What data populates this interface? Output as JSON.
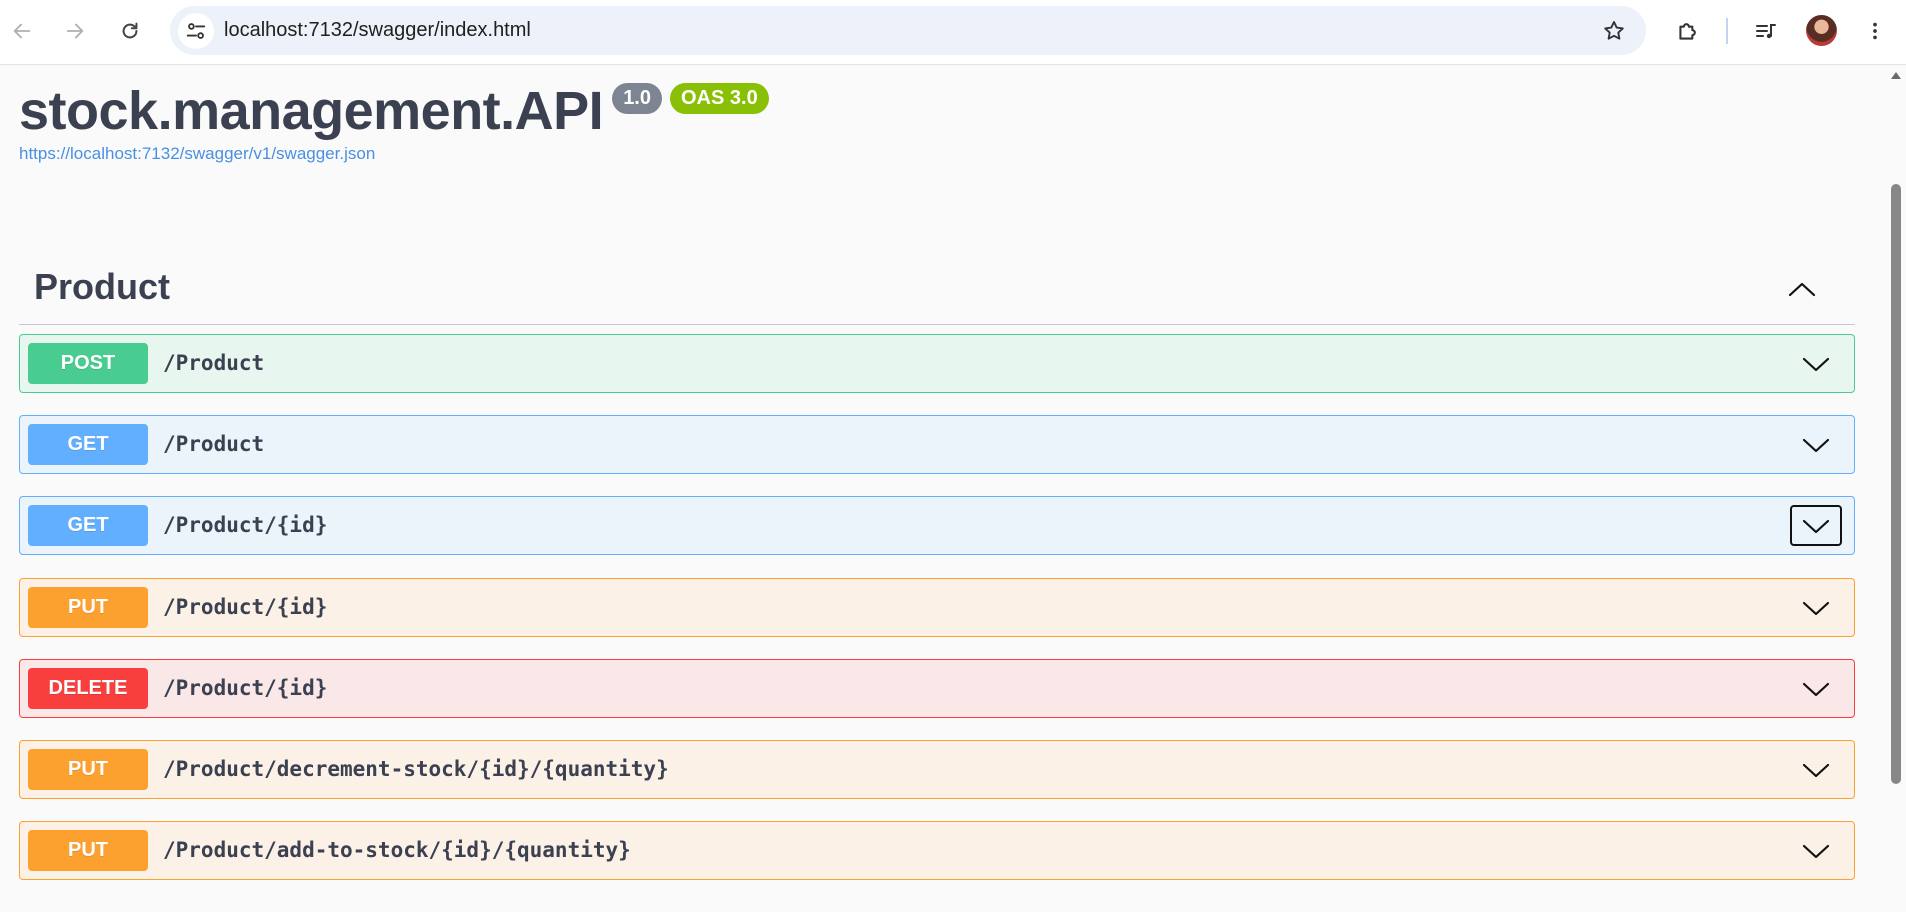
{
  "browser": {
    "url": "localhost:7132/swagger/index.html",
    "icons": {
      "back": "back-arrow-icon",
      "forward": "forward-arrow-icon",
      "reload": "reload-icon",
      "site_info": "tune-icon",
      "bookmark": "star-icon",
      "extensions": "puzzle-icon",
      "media": "media-queue-icon",
      "profile": "avatar",
      "menu": "kebab-menu-icon"
    }
  },
  "api": {
    "title": "stock.management.API",
    "version": "1.0",
    "oas_badge": "OAS 3.0",
    "spec_url": "https://localhost:7132/swagger/v1/swagger.json"
  },
  "tag": {
    "name": "Product",
    "expanded": true
  },
  "operations": [
    {
      "method": "POST",
      "path": "/Product"
    },
    {
      "method": "GET",
      "path": "/Product"
    },
    {
      "method": "GET",
      "path": "/Product/{id}"
    },
    {
      "method": "PUT",
      "path": "/Product/{id}"
    },
    {
      "method": "DELETE",
      "path": "/Product/{id}"
    },
    {
      "method": "PUT",
      "path": "/Product/decrement-stock/{id}/{quantity}"
    },
    {
      "method": "PUT",
      "path": "/Product/add-to-stock/{id}/{quantity}"
    }
  ],
  "colors": {
    "post": "#49cc90",
    "get": "#61affe",
    "put": "#fca130",
    "delete": "#f93e3e",
    "title": "#3b4151",
    "link": "#4990e2",
    "version_badge": "#7d8492",
    "oas_badge": "#89bf04"
  }
}
